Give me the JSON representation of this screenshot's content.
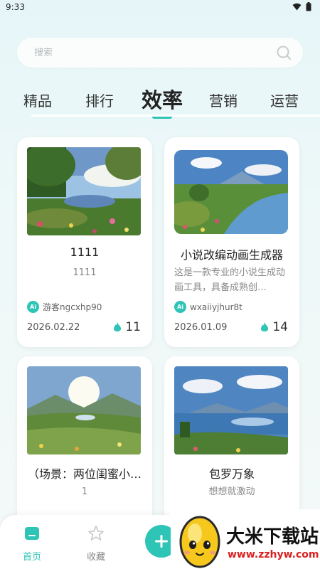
{
  "status": {
    "time": "9:33"
  },
  "search": {
    "placeholder": "搜索"
  },
  "tabs": [
    {
      "label": "精品"
    },
    {
      "label": "排行"
    },
    {
      "label": "效率"
    },
    {
      "label": "营销"
    },
    {
      "label": "运营"
    }
  ],
  "active_tab": "效率",
  "cards": [
    {
      "title": "1111",
      "desc": "1111",
      "author": "游客ngcxhp90",
      "date": "2026.02.22",
      "hot": "11"
    },
    {
      "title": "小说改编动画生成器",
      "desc": "这是一款专业的小说生成动画工具，具备成熟创…",
      "author": "wxaiiyjhur8t",
      "date": "2026.01.09",
      "hot": "14"
    },
    {
      "title": "（场景：两位闺蜜小…",
      "desc": "1"
    },
    {
      "title": "包罗万象",
      "desc": "想想就激动"
    }
  ],
  "ai_badge": "Ai",
  "nav": {
    "home": "首页",
    "favorites": "收藏"
  },
  "watermark": {
    "title": "大米下载站",
    "url": "www.zzhyw.com"
  },
  "colors": {
    "accent": "#2ec4b6",
    "background": "#e6f6f8"
  }
}
